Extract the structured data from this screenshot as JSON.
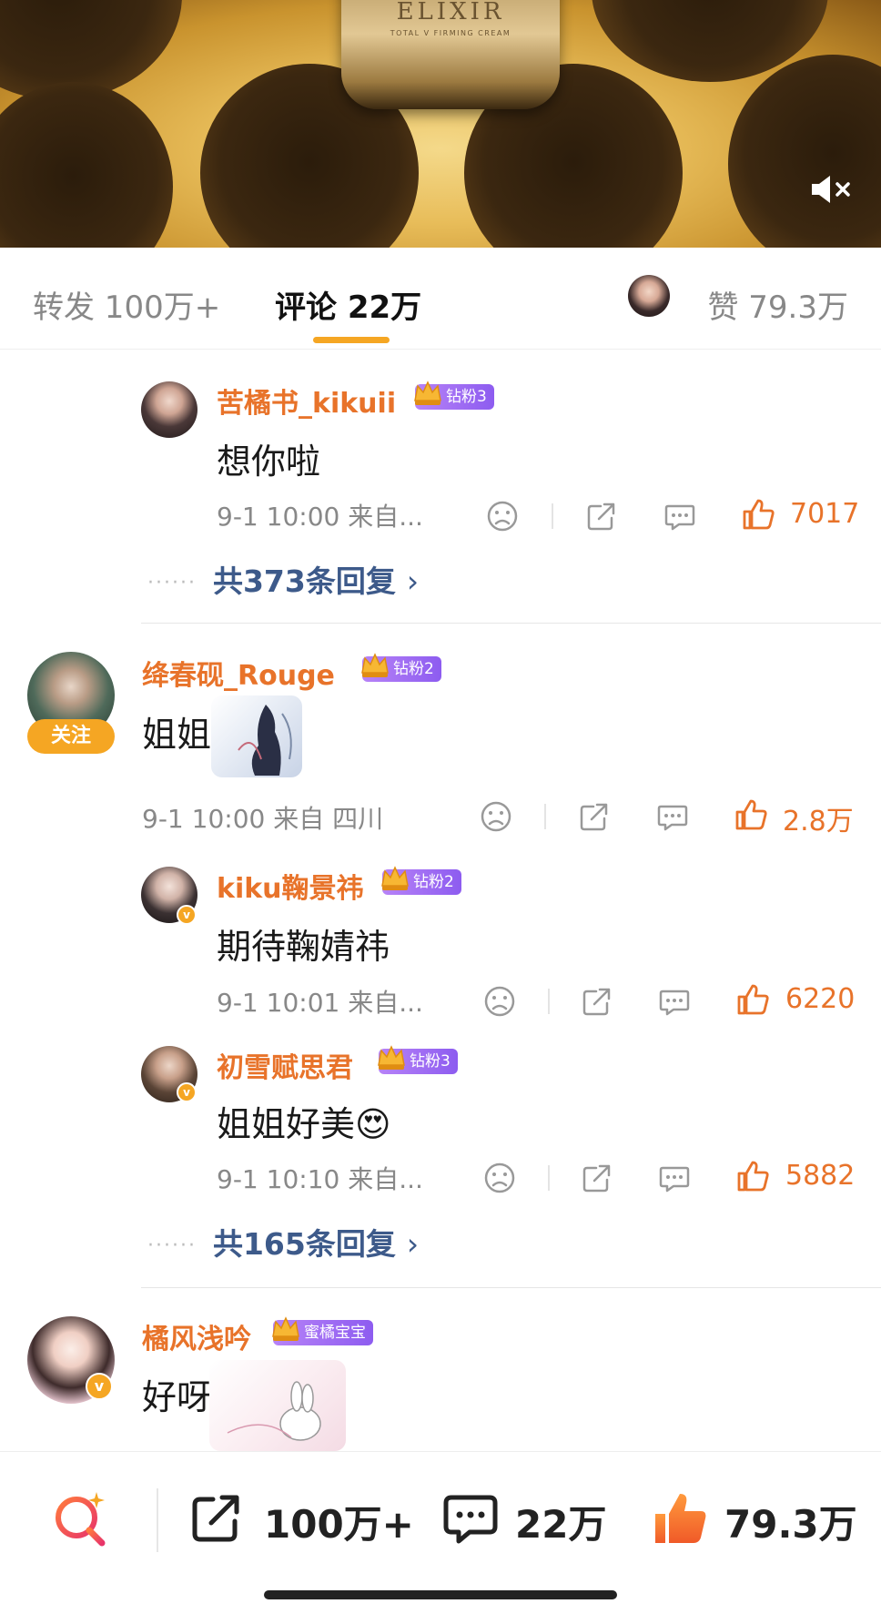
{
  "hero": {
    "brand": "ELIXIR",
    "product": "TOTAL V FIRMING CREAM"
  },
  "tabs": {
    "repost": "转发 100万+",
    "comments": "评论 22万",
    "likes": "赞 79.3万"
  },
  "comments": [
    {
      "type": "reply",
      "name": "苦橘书_kikuii",
      "badge": "钻粉3",
      "text": "想你啦",
      "time": "9-1 10:00 来自...",
      "likes": "7017"
    },
    {
      "more_replies": "共373条回复"
    },
    {
      "type": "top",
      "name": "绛春砚_Rouge",
      "badge": "钻粉2",
      "follow": "关注",
      "text": "姐姐",
      "time": "9-1 10:00 来自 四川",
      "likes": "2.8万"
    },
    {
      "type": "reply",
      "name": "kiku鞠景祎",
      "badge": "钻粉2",
      "text": "期待鞠婧祎",
      "time": "9-1 10:01 来自...",
      "likes": "6220"
    },
    {
      "type": "reply",
      "name": "初雪赋思君",
      "badge": "钻粉3",
      "text": "姐姐好美",
      "emoji": "😍",
      "time": "9-1 10:10 来自...",
      "likes": "5882"
    },
    {
      "more_replies": "共165条回复"
    },
    {
      "type": "top",
      "name": "橘风浅吟",
      "badge": "蜜橘宝宝",
      "text": "好呀",
      "emoji": "😘"
    }
  ],
  "bottom_bar": {
    "repost_count": "100万+",
    "comment_count": "22万",
    "like_count": "79.3万"
  },
  "colors": {
    "accent": "#f5a623",
    "name": "#e8732a",
    "link": "#3d5a8a",
    "badge": "#9b6cf3"
  }
}
